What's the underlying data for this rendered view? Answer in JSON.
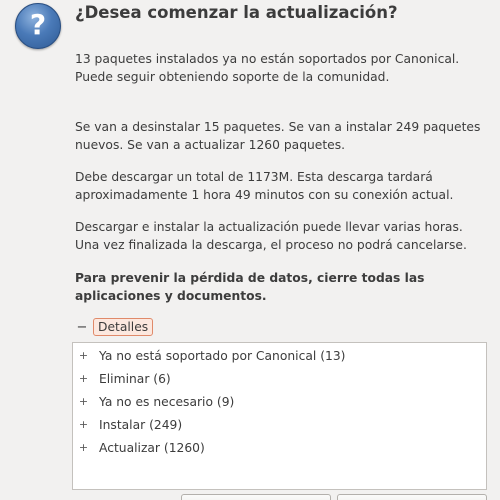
{
  "dialog": {
    "title": "¿Desea comenzar la actualización?",
    "icon": "question-icon",
    "paragraphs": [
      "13 paquetes instalados ya no están soportados por Canonical. Puede seguir obteniendo soporte de la comunidad.",
      "Se van a desinstalar 15 paquetes. Se van a instalar 249 paquetes nuevos. Se van a actualizar 1260 paquetes.",
      "Debe descargar un total de 1173M. Esta descarga tardará aproximadamente 1 hora 49 minutos con su conexión actual.",
      "Descargar e instalar la actualización puede llevar varias horas. Una vez finalizada la descarga, el proceso no podrá cancelarse."
    ],
    "warning": "Para prevenir la pérdida de datos, cierre todas las aplicaciones y documentos."
  },
  "details": {
    "toggle_symbol": "−",
    "label": "Detalles",
    "expanded": true,
    "items": [
      {
        "toggle": "+",
        "label": "Ya no está soportado por Canonical (13)"
      },
      {
        "toggle": "+",
        "label": "Eliminar (6)"
      },
      {
        "toggle": "+",
        "label": "Ya no es necesario (9)"
      },
      {
        "toggle": "+",
        "label": "Instalar (249)"
      },
      {
        "toggle": "+",
        "label": "Actualizar (1260)"
      }
    ]
  },
  "colors": {
    "background": "#f2f1f0",
    "text": "#3c3c3c",
    "focus_border": "#e08a6a",
    "icon_blue": "#4a7ab8"
  }
}
